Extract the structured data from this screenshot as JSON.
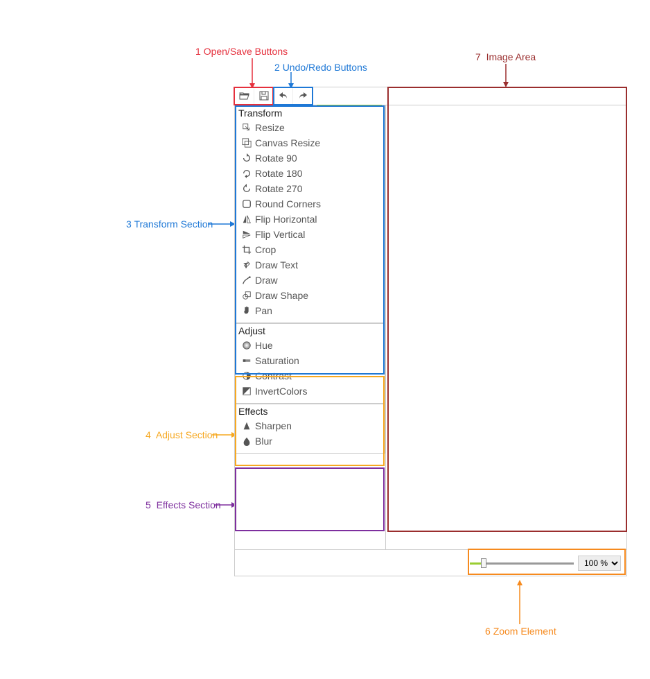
{
  "annotations": {
    "openSave": {
      "num": "1",
      "text": "Open/Save Buttons",
      "color": "#E5303D"
    },
    "undoRedo": {
      "num": "2",
      "text": "Undo/Redo Buttons",
      "color": "#1E78D6"
    },
    "transform": {
      "num": "3",
      "text": "Transform Section",
      "color": "#1E78D6"
    },
    "adjust": {
      "num": "4",
      "text": "Adjust Section",
      "color": "#F6A821"
    },
    "effects": {
      "num": "5",
      "text": "Effects Section",
      "color": "#7E2F9E"
    },
    "zoom": {
      "num": "6",
      "text": "Zoom Element",
      "color": "#F68A1E"
    },
    "image": {
      "num": "7",
      "text": "Image Area",
      "color": "#9A2E2E"
    }
  },
  "sections": {
    "transform": {
      "title": "Transform",
      "items": [
        {
          "icon": "resize",
          "label": "Resize"
        },
        {
          "icon": "canvas-resize",
          "label": "Canvas Resize"
        },
        {
          "icon": "rotate-90",
          "label": "Rotate 90"
        },
        {
          "icon": "rotate-180",
          "label": "Rotate 180"
        },
        {
          "icon": "rotate-270",
          "label": "Rotate 270"
        },
        {
          "icon": "round-corners",
          "label": "Round Corners"
        },
        {
          "icon": "flip-horizontal",
          "label": "Flip Horizontal"
        },
        {
          "icon": "flip-vertical",
          "label": "Flip Vertical"
        },
        {
          "icon": "crop",
          "label": "Crop"
        },
        {
          "icon": "draw-text",
          "label": "Draw Text"
        },
        {
          "icon": "draw",
          "label": "Draw"
        },
        {
          "icon": "draw-shape",
          "label": "Draw Shape"
        },
        {
          "icon": "pan",
          "label": "Pan"
        }
      ]
    },
    "adjust": {
      "title": "Adjust",
      "items": [
        {
          "icon": "hue",
          "label": "Hue"
        },
        {
          "icon": "saturation",
          "label": "Saturation"
        },
        {
          "icon": "contrast",
          "label": "Contrast"
        },
        {
          "icon": "invert",
          "label": "InvertColors"
        }
      ]
    },
    "effects": {
      "title": "Effects",
      "items": [
        {
          "icon": "sharpen",
          "label": "Sharpen"
        },
        {
          "icon": "blur",
          "label": "Blur"
        }
      ]
    }
  },
  "zoom": {
    "value": "100 %",
    "position_pct": 12
  }
}
